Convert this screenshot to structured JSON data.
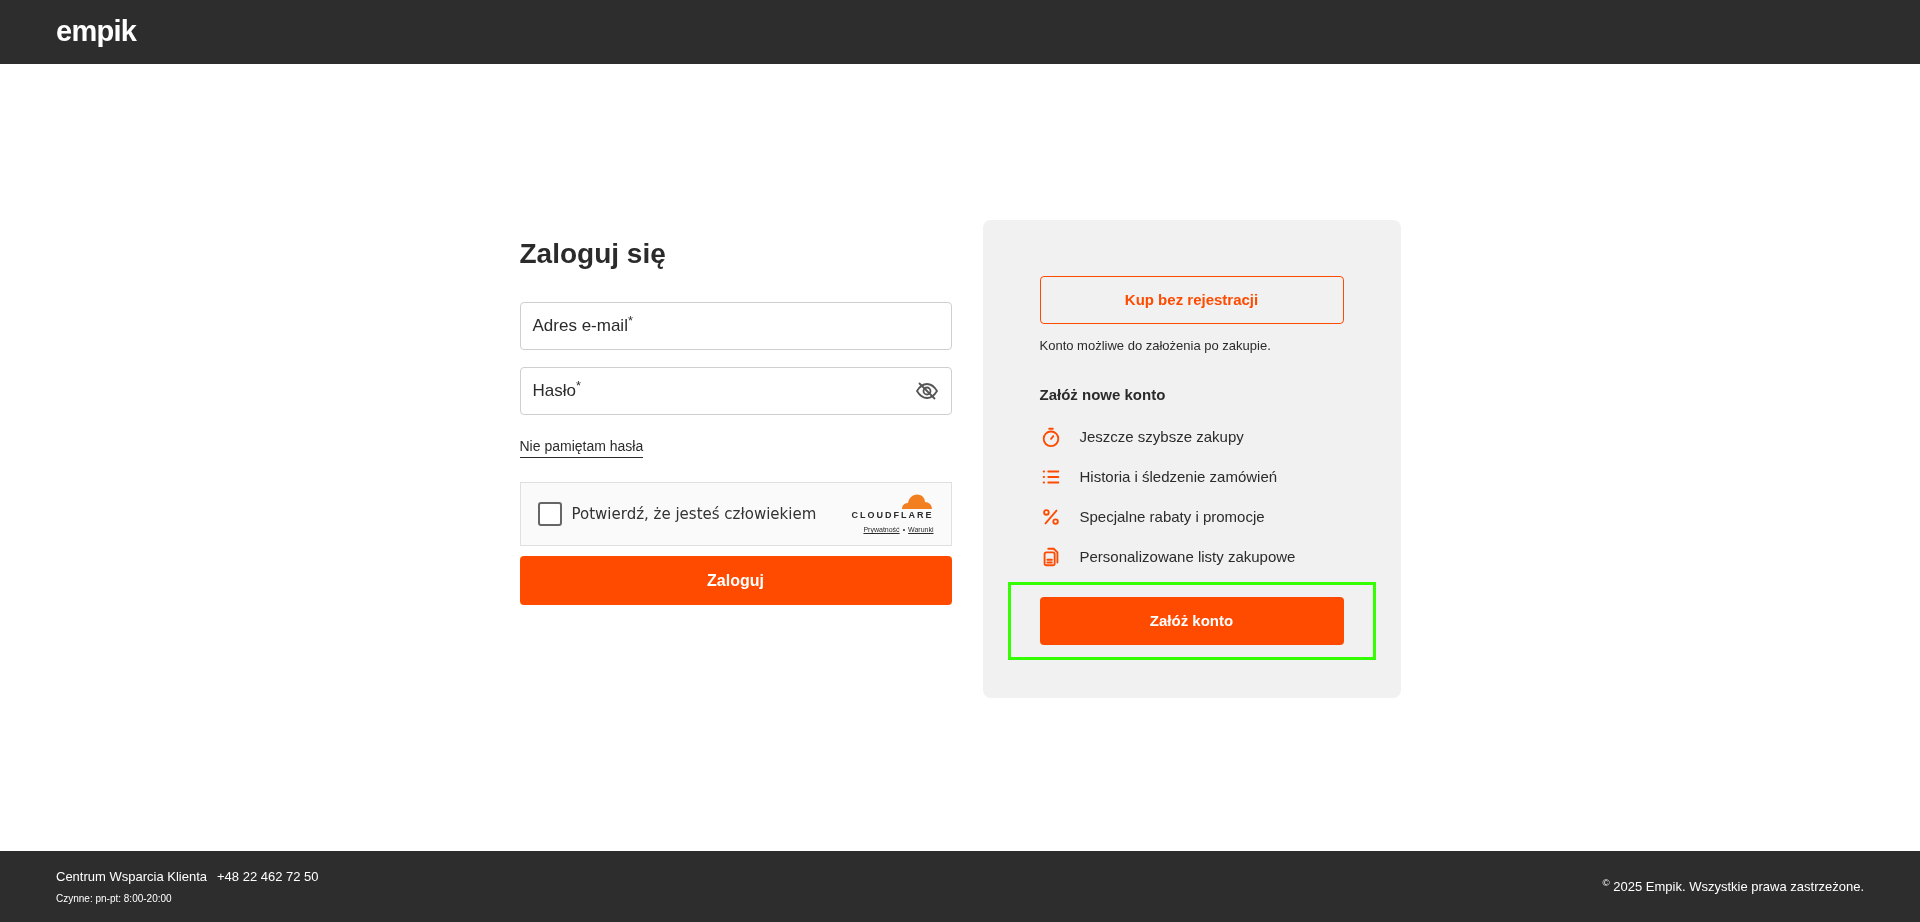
{
  "header": {
    "logo": "empik"
  },
  "login": {
    "title": "Zaloguj się",
    "fields": [
      {
        "kind": "text",
        "label": "Adres e-mail$^{*}$"
      },
      {
        "kind": "password",
        "label": "Hasło$^{*}$"
      }
    ],
    "forgot_link": "Nie pamiętam hasła",
    "captcha": {
      "checked": false,
      "label": "Potwierdź, że jesteś człowiekiem",
      "brand": "CLOUDFLARE",
      "links": [
        "Prywatność",
        "Warunki"
      ],
      "separator": "•"
    },
    "submit": "Zaloguj"
  },
  "register": {
    "guest_button": "Kup bez rejestracji",
    "guest_note": "Konto możliwe do założenia po zakupie.",
    "title": "Załóż nowe konto",
    "benefits": [
      {
        "kind": "stopwatch",
        "text": "Jeszcze szybsze zakupy"
      },
      {
        "kind": "list",
        "text": "Historia i śledzenie zamówień"
      },
      {
        "kind": "percent",
        "text": "Specjalne rabaty i promocje"
      },
      {
        "kind": "documents",
        "text": "Personalizowane listy zakupowe"
      }
    ],
    "create_button": {
      "label": "Załóż konto",
      "highlighted": true
    }
  },
  "footer": {
    "support": "Centrum Wsparcia Klienta",
    "phone": "+48 22 462 72 50",
    "hours": "Czynne: pn-pt: 8:00-20:00",
    "copyright": "$^{©}$ 2025 Empik. Wszystkie prawa zastrzeżone."
  }
}
